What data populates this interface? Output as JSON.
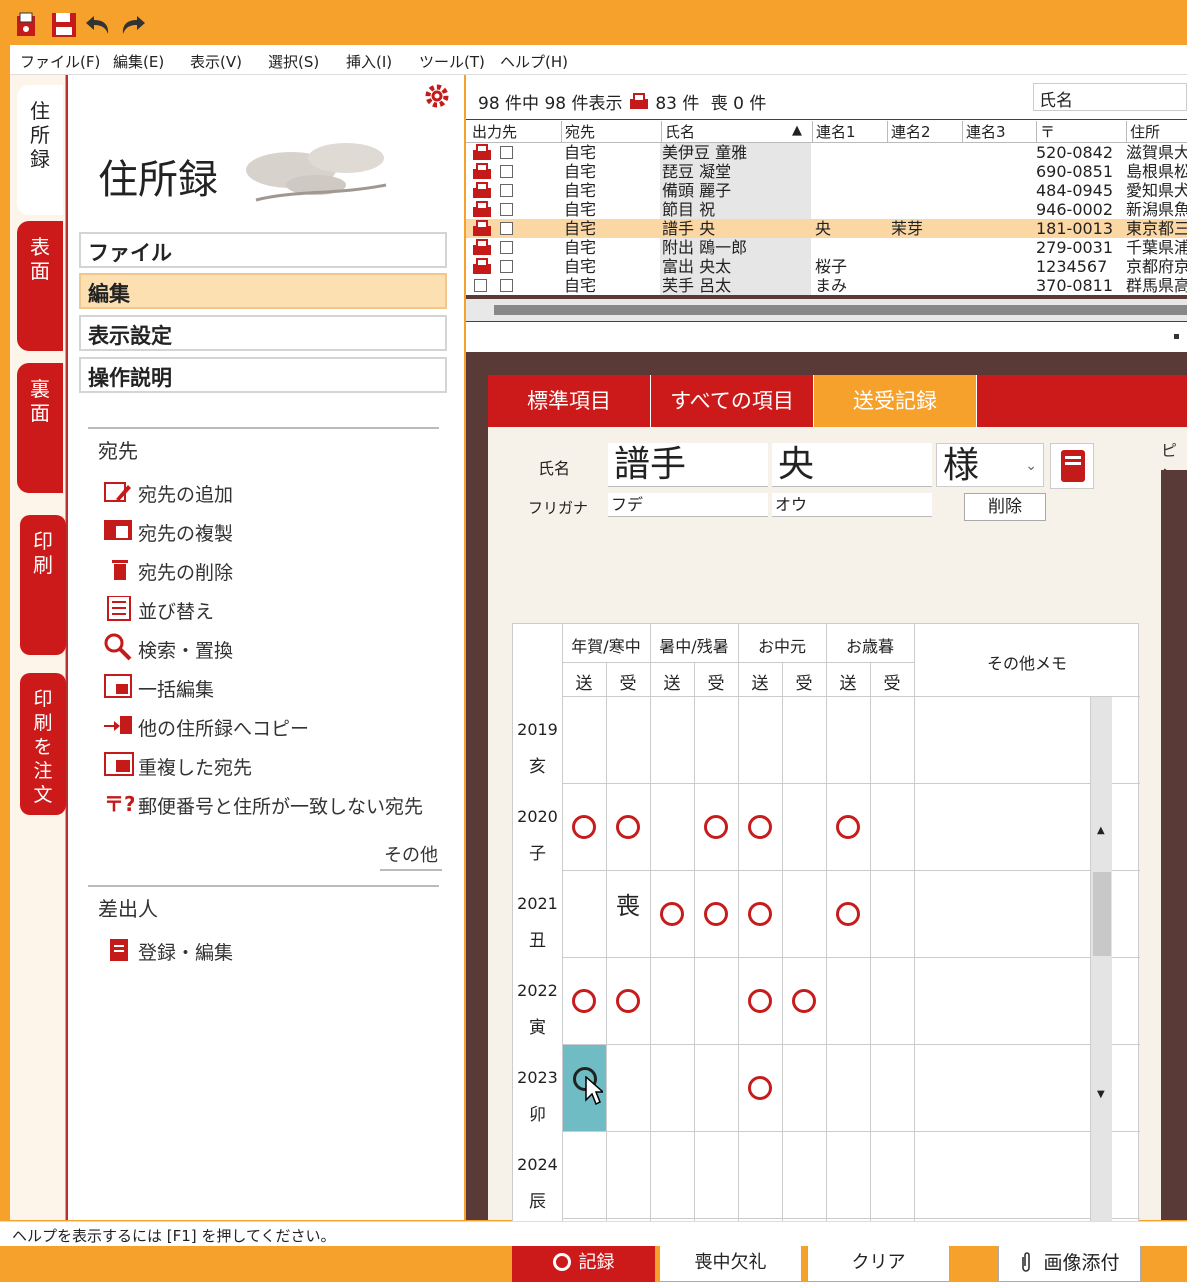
{
  "titlebar": {
    "icons": [
      "app-icon",
      "save-icon",
      "undo-icon",
      "redo-icon"
    ]
  },
  "menubar": [
    "ファイル(F)",
    "編集(E)",
    "表示(V)",
    "選択(S)",
    "挿入(I)",
    "ツール(T)",
    "ヘルプ(H)"
  ],
  "side_tabs": {
    "address": "住所録",
    "front": "表面",
    "back": "裏面",
    "print": "印刷",
    "order": "印刷を注文"
  },
  "left": {
    "title": "住所録",
    "accordion": {
      "file": "ファイル",
      "edit": "編集",
      "display": "表示設定",
      "manual": "操作説明"
    },
    "dest_section": "宛先",
    "dest_items": [
      "宛先の追加",
      "宛先の複製",
      "宛先の削除",
      "並び替え",
      "検索・置換",
      "一括編集",
      "他の住所録へコピー",
      "重複した宛先",
      "郵便番号と住所が一致しない宛先"
    ],
    "more": "その他",
    "sender_section": "差出人",
    "sender_item": "登録・編集"
  },
  "list": {
    "total": "98",
    "shown": "98",
    "t_count_of": "件中",
    "t_shown": "件表示",
    "print_count": "83",
    "t_ken": "件",
    "mourning_label": "喪",
    "mourning_count": "0",
    "t_ken2": "件",
    "search_field": "氏名",
    "headers": {
      "output": "出力先",
      "dest": "宛先",
      "name": "氏名",
      "sort": "▲",
      "co1": "連名1",
      "co2": "連名2",
      "co3": "連名3",
      "zip": "〒",
      "addr": "住所"
    },
    "rows": [
      {
        "dest": "自宅",
        "name": "美伊豆 童雅",
        "co1": "",
        "co2": "",
        "zip": "520-0842",
        "addr": "滋賀県大"
      },
      {
        "dest": "自宅",
        "name": "琵豆 凝堂",
        "co1": "",
        "co2": "",
        "zip": "690-0851",
        "addr": "島根県松"
      },
      {
        "dest": "自宅",
        "name": "備頭 麗子",
        "co1": "",
        "co2": "",
        "zip": "484-0945",
        "addr": "愛知県犬"
      },
      {
        "dest": "自宅",
        "name": "節目 祝",
        "co1": "",
        "co2": "",
        "zip": "946-0002",
        "addr": "新潟県魚"
      },
      {
        "dest": "自宅",
        "name": "譜手 央",
        "co1": "央",
        "co2": "茉芽",
        "zip": "181-0013",
        "addr": "東京都三"
      },
      {
        "dest": "自宅",
        "name": "附出 鴎一郎",
        "co1": "",
        "co2": "",
        "zip": "279-0031",
        "addr": "千葉県浦"
      },
      {
        "dest": "自宅",
        "name": "富出 央太",
        "co1": "桜子",
        "co2": "",
        "zip": "1234567",
        "addr": "京都府京"
      },
      {
        "dest": "自宅",
        "name": "芙手 呂太",
        "co1": "まみ",
        "co2": "",
        "zip": "370-0811",
        "addr": "群馬県高"
      }
    ]
  },
  "detail": {
    "tabs": [
      "標準項目",
      "すべての項目",
      "送受記録"
    ],
    "side_label": "ピン",
    "name_label": "氏名",
    "last_name": "譜手",
    "first_name": "央",
    "honorific": "様",
    "kana_label": "フリガナ",
    "kana_last": "フデ",
    "kana_first": "オウ",
    "delete_btn": "削除",
    "col_groups": [
      "年賀/寒中",
      "暑中/残暑",
      "お中元",
      "お歳暮"
    ],
    "send": "送",
    "recv": "受",
    "memo": "その他メモ",
    "years": [
      {
        "year": "2019",
        "eto": "亥"
      },
      {
        "year": "2020",
        "eto": "子"
      },
      {
        "year": "2021",
        "eto": "丑"
      },
      {
        "year": "2022",
        "eto": "寅"
      },
      {
        "year": "2023",
        "eto": "卯"
      },
      {
        "year": "2024",
        "eto": "辰"
      }
    ],
    "mourning_mark": "喪",
    "buttons": {
      "record": "記録",
      "mourning": "喪中欠礼",
      "clear": "クリア",
      "attach": "画像添付"
    }
  },
  "status": "ヘルプを表示するには [F1] を押してください。"
}
